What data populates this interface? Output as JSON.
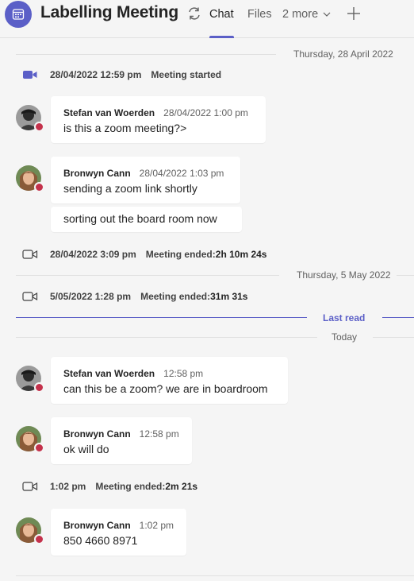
{
  "header": {
    "title": "Labelling Meeting",
    "tabs": [
      {
        "label": "Chat",
        "active": true
      },
      {
        "label": "Files",
        "active": false
      },
      {
        "label": "2 more",
        "active": false
      }
    ]
  },
  "dates": {
    "d1": "Thursday, 28 April 2022",
    "d2": "Thursday, 5 May 2022",
    "today": "Today"
  },
  "last_read": "Last read",
  "events": [
    {
      "time": "28/04/2022 12:59 pm",
      "text": "Meeting started",
      "duration": ""
    },
    {
      "time": "28/04/2022 3:09 pm",
      "text": "Meeting ended: ",
      "duration": "2h 10m 24s"
    },
    {
      "time": "5/05/2022 1:28 pm",
      "text": "Meeting ended: ",
      "duration": "31m 31s"
    },
    {
      "time": "1:02 pm",
      "text": "Meeting ended: ",
      "duration": "2m 21s"
    }
  ],
  "messages": [
    {
      "author": "Stefan van Woerden",
      "time": "28/04/2022 1:00 pm",
      "text": "is this a zoom meeting?>"
    },
    {
      "author": "Bronwyn Cann",
      "time": "28/04/2022 1:03 pm",
      "text": "sending a zoom link shortly"
    },
    {
      "text": "sorting out the board room now"
    },
    {
      "author": "Stefan van Woerden",
      "time": "12:58 pm",
      "text": "can this be a zoom? we are in boardroom"
    },
    {
      "author": "Bronwyn Cann",
      "time": "12:58 pm",
      "text": "ok will do"
    },
    {
      "author": "Bronwyn Cann",
      "time": "1:02 pm",
      "text": "850 4660 8971"
    }
  ],
  "colors": {
    "accent": "#5b5fc7",
    "status_busy": "#c4314b",
    "background": "#f5f5f5"
  },
  "icons": {
    "app": "calendar-icon",
    "sync": "sync-icon",
    "add": "add-tab-icon",
    "meeting_start": "video-camera-filled-icon",
    "meeting_end": "video-camera-outline-icon"
  }
}
